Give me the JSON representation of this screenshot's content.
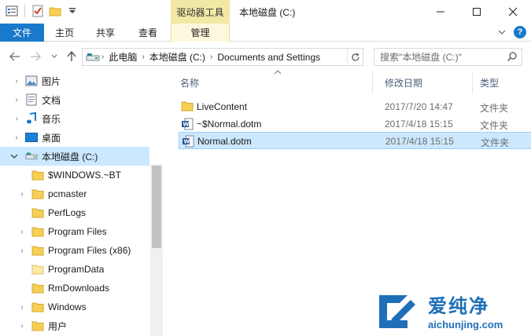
{
  "colors": {
    "file_tab": "#1979ca",
    "context_tab": "#f2e8a6",
    "selection": "#cce8ff",
    "folder": "#f6cf57",
    "watermark": "#1e6fb8"
  },
  "titlebar": {
    "context_tab_title": "驱动器工具",
    "window_title": "本地磁盘 (C:)",
    "qat_icons": [
      "properties-icon",
      "checkmark-icon",
      "new-folder-icon",
      "customize-qat-icon"
    ],
    "controls": [
      "minimize-icon",
      "maximize-icon",
      "close-icon"
    ]
  },
  "ribbon": {
    "tabs": [
      {
        "label": "文件"
      },
      {
        "label": "主页"
      },
      {
        "label": "共享"
      },
      {
        "label": "查看"
      },
      {
        "label": "管理"
      }
    ],
    "help_label": "?"
  },
  "address": {
    "breadcrumbs": [
      "此电脑",
      "本地磁盘 (C:)",
      "Documents and Settings"
    ],
    "search_placeholder": "搜索\"本地磁盘 (C:)\""
  },
  "nav_pane": {
    "items": [
      {
        "label": "图片",
        "icon": "pictures-icon"
      },
      {
        "label": "文档",
        "icon": "documents-icon"
      },
      {
        "label": "音乐",
        "icon": "music-icon"
      },
      {
        "label": "桌面",
        "icon": "desktop-icon"
      },
      {
        "label": "本地磁盘 (C:)",
        "icon": "drive-icon",
        "selected": true
      },
      {
        "label": "$WINDOWS.~BT",
        "icon": "folder-icon"
      },
      {
        "label": "pcmaster",
        "icon": "folder-icon"
      },
      {
        "label": "PerfLogs",
        "icon": "folder-icon"
      },
      {
        "label": "Program Files",
        "icon": "folder-icon"
      },
      {
        "label": "Program Files (x86)",
        "icon": "folder-icon"
      },
      {
        "label": "ProgramData",
        "icon": "folder-icon"
      },
      {
        "label": "RmDownloads",
        "icon": "folder-icon"
      },
      {
        "label": "Windows",
        "icon": "folder-icon"
      },
      {
        "label": "用户",
        "icon": "folder-icon"
      }
    ]
  },
  "file_list": {
    "columns": [
      "名称",
      "修改日期",
      "类型"
    ],
    "rows": [
      {
        "name": "LiveContent",
        "date": "2017/7/20 14:47",
        "type": "文件夹",
        "icon": "folder-icon"
      },
      {
        "name": "~$Normal.dotm",
        "date": "2017/4/18 15:15",
        "type": "文件夹",
        "icon": "word-doc-icon"
      },
      {
        "name": "Normal.dotm",
        "date": "2017/4/18 15:15",
        "type": "文件夹",
        "icon": "word-doc-icon",
        "selected": true
      }
    ]
  },
  "watermark": {
    "title": "爱纯净",
    "subtitle": "aichunjing.com"
  }
}
